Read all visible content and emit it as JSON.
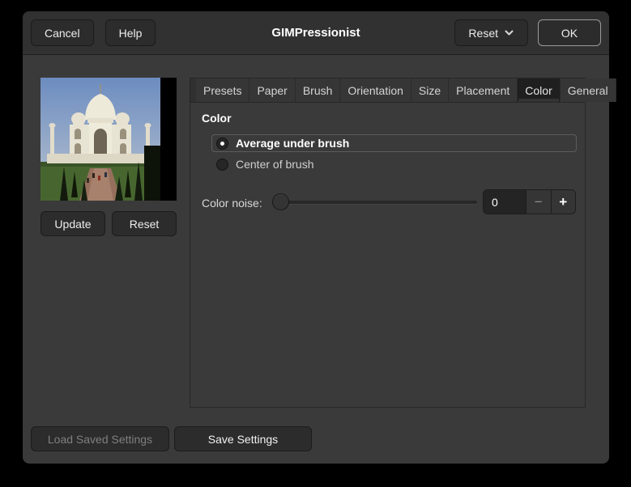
{
  "window": {
    "title": "GIMPressionist"
  },
  "header": {
    "cancel_label": "Cancel",
    "help_label": "Help",
    "reset_label": "Reset",
    "ok_label": "OK"
  },
  "preview": {
    "update_label": "Update",
    "reset_label": "Reset"
  },
  "tabs": [
    "Presets",
    "Paper",
    "Brush",
    "Orientation",
    "Size",
    "Placement",
    "Color",
    "General"
  ],
  "active_tab": "Color",
  "color_panel": {
    "heading": "Color",
    "options": [
      {
        "label": "Average under brush",
        "selected": true
      },
      {
        "label": "Center of brush",
        "selected": false
      }
    ],
    "noise_label": "Color noise:",
    "noise_value": "0",
    "noise_minus_glyph": "−",
    "noise_plus_glyph": "+",
    "slider_position_percent": 0
  },
  "footer": {
    "load_label": "Load Saved Settings",
    "load_enabled": false,
    "save_label": "Save Settings"
  },
  "colors": {
    "outer_bg": "#000000",
    "window_bg": "#3a3a3a",
    "header_bg": "#313131",
    "button_bg": "#2c2c2c",
    "active_tab_bg": "#1f1f1f",
    "inactive_tab_bg": "#363636",
    "entry_bg": "#242424",
    "focus_border": "#5c5c5c",
    "default_button_border": "#9a9a9a",
    "text": "#ededed",
    "disabled_text": "#7f7f7f"
  }
}
